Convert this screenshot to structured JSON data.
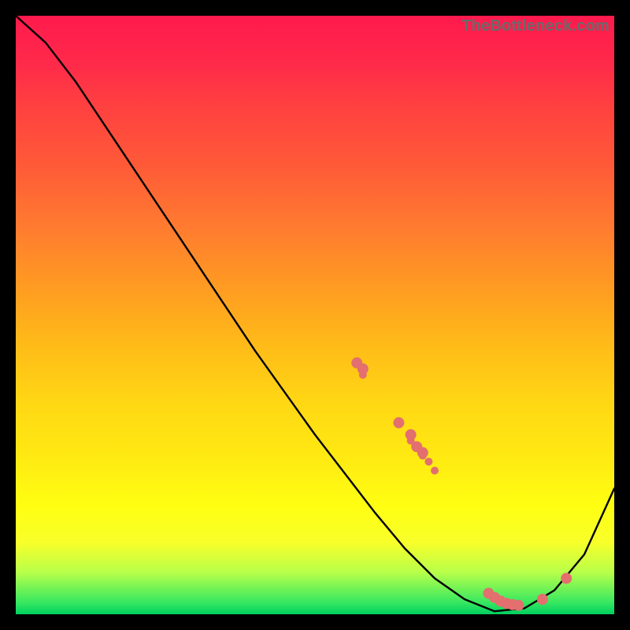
{
  "domain": "Chart",
  "watermark": "TheBottleneck.com",
  "colors": {
    "background": "#000000",
    "gradient_top": "#ff1a4d",
    "gradient_bottom": "#00d060",
    "curve": "#000000",
    "points": "#e36f6f"
  },
  "chart_data": {
    "type": "line",
    "title": "",
    "xlabel": "",
    "ylabel": "",
    "xlim": [
      0,
      100
    ],
    "ylim": [
      0,
      100
    ],
    "x": [
      0,
      5,
      10,
      15,
      20,
      25,
      30,
      35,
      40,
      45,
      50,
      55,
      60,
      65,
      70,
      75,
      80,
      85,
      90,
      95,
      100
    ],
    "values": [
      100,
      95.5,
      89,
      81.5,
      74,
      66.5,
      59,
      51.5,
      44,
      37,
      30,
      23.5,
      17,
      11,
      6,
      2.5,
      0.5,
      1,
      4,
      10,
      21
    ],
    "scatter_overlay": {
      "x": [
        57,
        58,
        58,
        64,
        66,
        66,
        67,
        68,
        68,
        69,
        70,
        79,
        80,
        81,
        82,
        83,
        84,
        88,
        92
      ],
      "values": [
        42,
        41,
        40,
        32,
        30,
        29,
        28,
        27,
        26.5,
        25.5,
        24,
        3.5,
        2.8,
        2.2,
        1.8,
        1.6,
        1.5,
        2.5,
        6
      ],
      "radius_px": [
        7,
        7,
        5,
        7,
        7,
        5,
        7,
        7,
        5,
        5,
        5,
        7,
        7,
        7,
        7,
        7,
        7,
        7,
        7
      ]
    }
  }
}
